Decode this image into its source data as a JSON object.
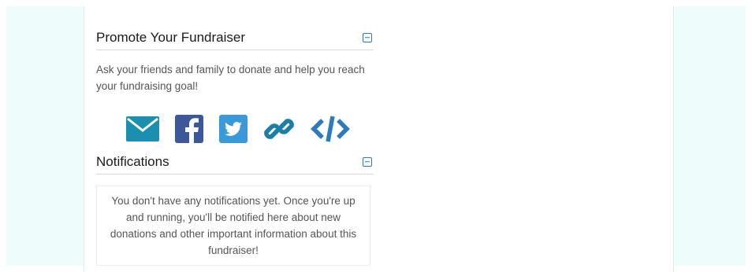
{
  "promote": {
    "title": "Promote Your Fundraiser",
    "description": "Ask your friends and family to donate and help you reach your fundraising goal!",
    "share_icons": [
      "email-icon",
      "facebook-icon",
      "twitter-icon",
      "link-icon",
      "embed-code-icon"
    ]
  },
  "notifications": {
    "title": "Notifications",
    "empty_message": "You don't have any notifications yet. Once you're up and running, you'll be notified here about new donations and other important information about this fundraiser!"
  },
  "colors": {
    "email": "#1a8fb0",
    "facebook": "#3b5998",
    "twitter": "#3a9ad9",
    "link": "#1a7fa8",
    "embed": "#2a7bbf",
    "accent": "#2a7bbf",
    "side_background": "#eefcfc"
  }
}
